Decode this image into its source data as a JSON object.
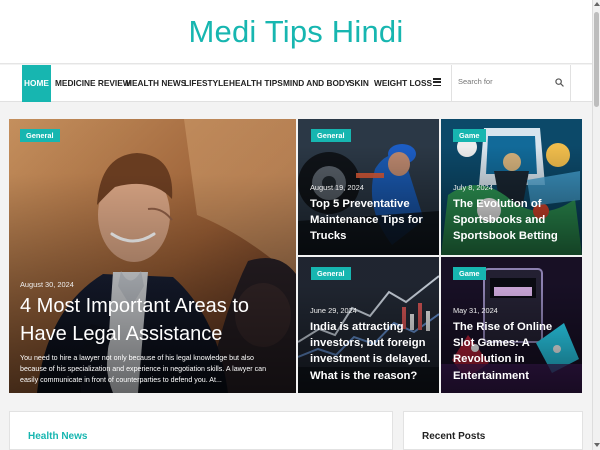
{
  "site": {
    "title": "Medi Tips Hindi"
  },
  "nav": {
    "items": [
      {
        "label": "HOME",
        "active": true
      },
      {
        "label": "MEDICINE REVIEW",
        "active": false
      },
      {
        "label": "HEALTH NEWS",
        "active": false
      },
      {
        "label": "LIFESTYLE",
        "active": false
      },
      {
        "label": "HEALTH TIPS",
        "active": false
      },
      {
        "label": "MIND AND BODY",
        "active": false
      },
      {
        "label": "SKIN",
        "active": false
      },
      {
        "label": "WEIGHT LOSS",
        "active": false
      }
    ],
    "more_icon": "hamburger-menu-icon",
    "search_placeholder": "Search for",
    "search_icon": "search-icon"
  },
  "featured": {
    "main": {
      "category": "General",
      "date": "August 30, 2024",
      "title": "4 Most Important Areas to Have Legal Assistance",
      "excerpt": "You need to hire a lawyer not only because of his legal knowledge but also because of his specialization and experience in negotiation skills. A lawyer can easily communicate in front of counterparties to defend you. At..."
    },
    "cards": [
      {
        "category": "General",
        "date": "August 19, 2024",
        "title": "Top 5 Preventative Maintenance Tips for Trucks"
      },
      {
        "category": "Game",
        "date": "July 8, 2024",
        "title": "The Evolution of Sportsbooks and Sportsbook Betting"
      },
      {
        "category": "General",
        "date": "June 29, 2024",
        "title": "India is attracting investors, but foreign investment is delayed. What is the reason?"
      },
      {
        "category": "Game",
        "date": "May 31, 2024",
        "title": "The Rise of Online Slot Games: A Revolution in Entertainment"
      }
    ]
  },
  "sections": {
    "health_news_title": "Health News",
    "recent_posts_title": "Recent Posts"
  },
  "colors": {
    "accent": "#17b6b0",
    "text": "#222222",
    "background": "#f3f3f3"
  }
}
